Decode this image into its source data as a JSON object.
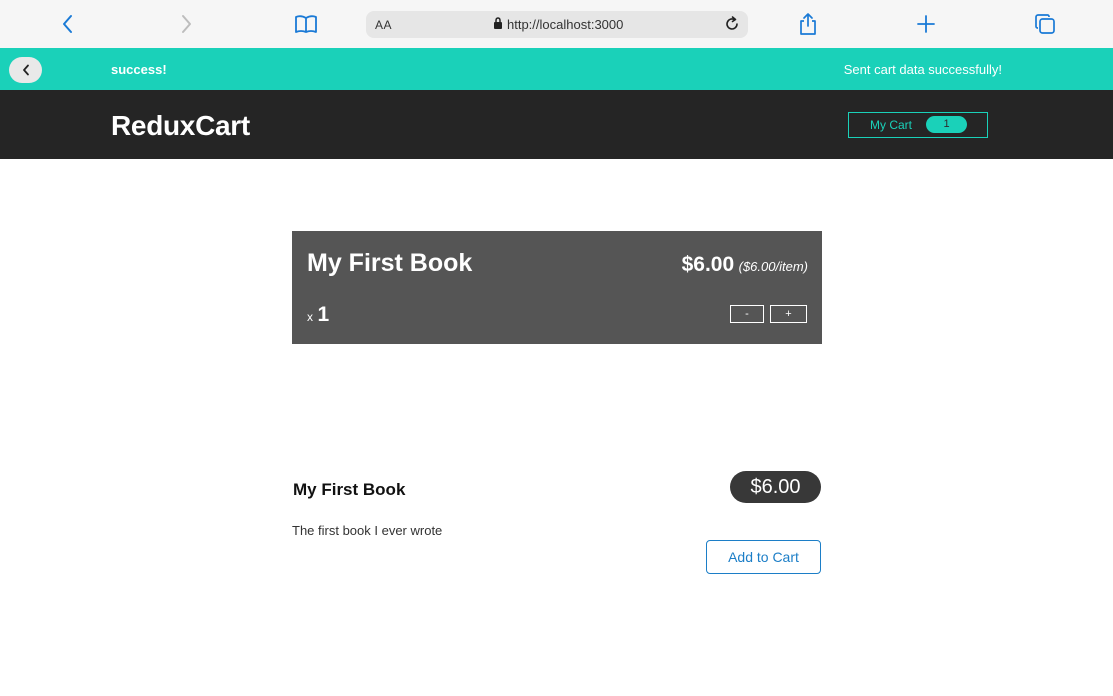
{
  "browser": {
    "aa_label": "AA",
    "url": "http://localhost:3000",
    "icons": [
      "chevron-left-icon",
      "chevron-right-icon",
      "book-icon",
      "lock-icon",
      "reload-icon",
      "share-icon",
      "plus-icon",
      "tabs-icon"
    ]
  },
  "notification": {
    "title": "success!",
    "message": "Sent cart data successfully!",
    "color": "#1ad1b9"
  },
  "header": {
    "logo": "ReduxCart",
    "cart_label": "My Cart",
    "cart_count": "1"
  },
  "cart": {
    "items": [
      {
        "title": "My First Book",
        "total": "$6.00",
        "per_item": "($6.00/item)",
        "quantity_prefix": "x",
        "quantity": "1",
        "decrement_label": "-",
        "increment_label": "+"
      }
    ]
  },
  "products": [
    {
      "title": "My First Book",
      "price": "$6.00",
      "description": "The first book I ever wrote",
      "button_label": "Add to Cart"
    }
  ],
  "colors": {
    "accent": "#1ad1b9",
    "header_bg": "#252525",
    "card_bg": "#555555",
    "link_blue": "#1c7ec7"
  }
}
